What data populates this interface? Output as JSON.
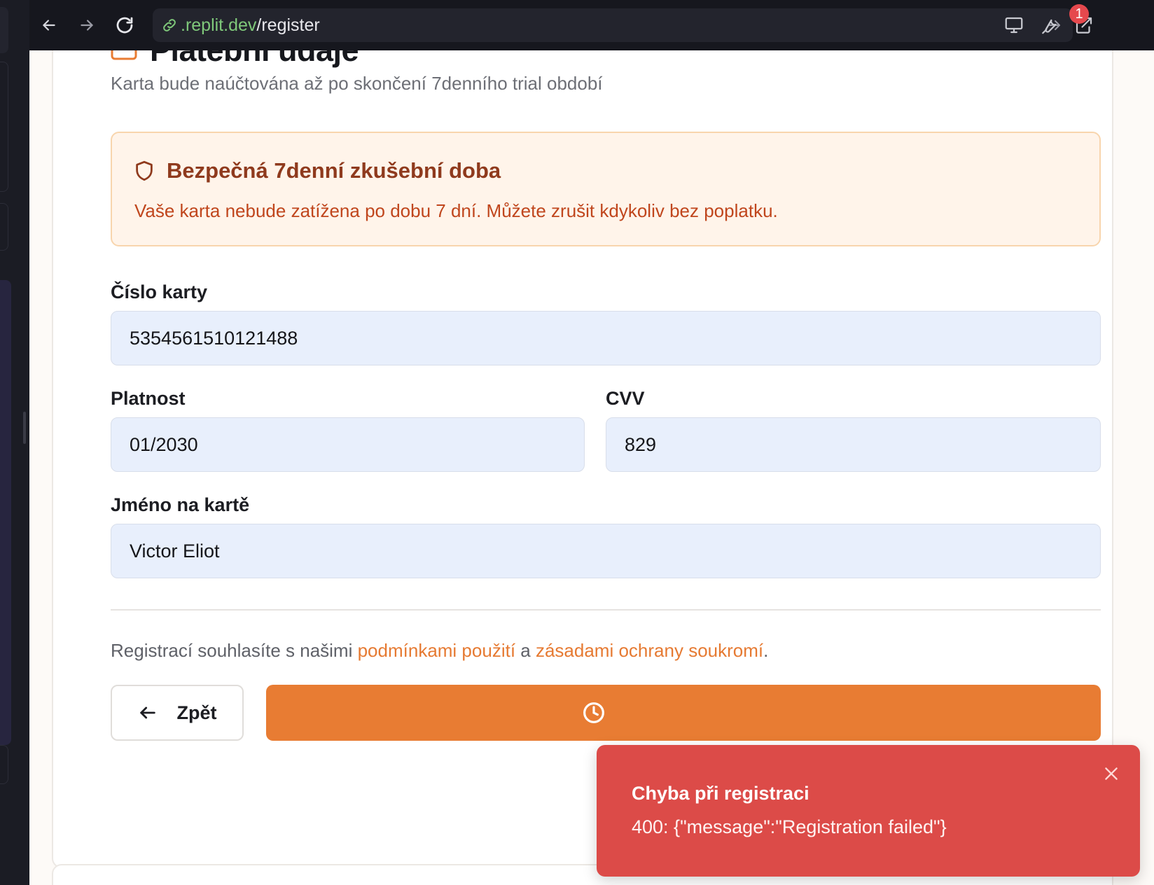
{
  "browser": {
    "url_domain": ".replit.dev",
    "url_path": "/register",
    "notification_count": "1"
  },
  "payment": {
    "title": "Platební údaje",
    "subtitle": "Karta bude naúčtována až po skončení 7denního trial období",
    "trial_title": "Bezpečná 7denní zkušební doba",
    "trial_text": "Vaše karta nebude zatížena po dobu 7 dní. Můžete zrušit kdykoliv bez poplatku."
  },
  "form": {
    "card_number_label": "Číslo karty",
    "card_number_value": "5354561510121488",
    "expiry_label": "Platnost",
    "expiry_value": "01/2030",
    "cvv_label": "CVV",
    "cvv_value": "829",
    "name_label": "Jméno na kartě",
    "name_value": "Victor Eliot"
  },
  "terms": {
    "prefix": "Registrací souhlasíte s našimi ",
    "terms_link": "podmínkami použití",
    "middle": " a ",
    "privacy_link": "zásadami ochrany soukromí",
    "suffix": "."
  },
  "actions": {
    "back_label": "Zpět"
  },
  "toast": {
    "title": "Chyba při registraci",
    "message": "400: {\"message\":\"Registration failed\"}"
  },
  "colors": {
    "accent": "#e87c33",
    "error": "#dc4b48",
    "trial_bg": "#fff4ea",
    "input_bg": "#e8effc"
  }
}
